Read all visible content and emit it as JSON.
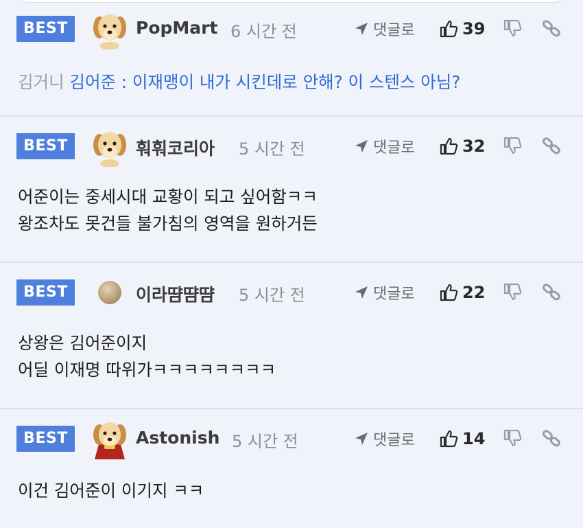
{
  "colors": {
    "badge": "#4f7fdc",
    "background": "#f1f3fa",
    "quote_text": "#2d6bd6",
    "mention_text": "#9aa0a8"
  },
  "reply_label": "댓글로",
  "comments": [
    {
      "badge": "BEST",
      "avatar": "puppy-avatar",
      "username": "PopMart",
      "time": "6 시간 전",
      "likes": "39",
      "mention": "김거니",
      "quote": "김어준 : 이재맹이 내가 시킨데로 안해? 이 스텐스 아님?"
    },
    {
      "badge": "BEST",
      "avatar": "puppy-avatar",
      "username": "훠훠코리아",
      "time": "5 시간 전",
      "likes": "32",
      "lines": [
        "어준이는 중세시대 교황이 되고 싶어함ㅋㅋ",
        "왕조차도 못건들 불가침의 영역을 원하거든"
      ]
    },
    {
      "badge": "BEST",
      "avatar": "ball-avatar",
      "username": "이라땸땸땸",
      "time": "5 시간 전",
      "likes": "22",
      "lines": [
        "상왕은 김어준이지",
        "어딜 이재명 따위가ㅋㅋㅋㅋㅋㅋㅋㅋ"
      ]
    },
    {
      "badge": "BEST",
      "avatar": "caped-puppy-avatar",
      "username": "Astonish",
      "time": "5 시간 전",
      "likes": "14",
      "lines": [
        "이건 김어준이 이기지 ㅋㅋ"
      ]
    }
  ]
}
